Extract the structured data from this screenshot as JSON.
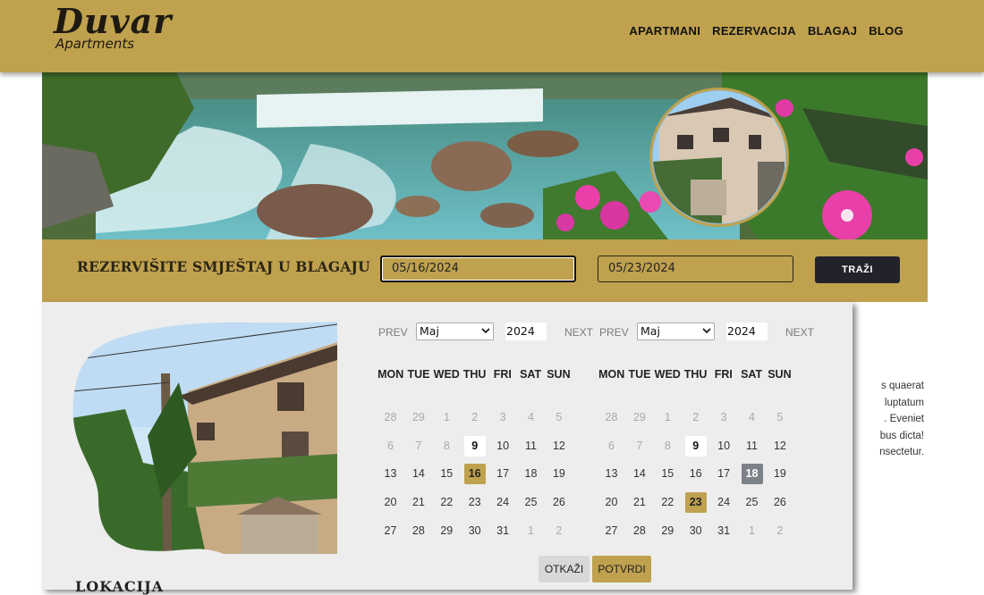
{
  "header": {
    "logo_main": "Duvar",
    "logo_sub": "Apartments",
    "nav": [
      "APARTMANI",
      "REZERVACIJA",
      "BLAGAJ",
      "BLOG"
    ]
  },
  "booking": {
    "title": "REZERVIŠITE SMJEŠTAJ U BLAGAJU",
    "check_in": "05/16/2024",
    "check_out": "05/23/2024",
    "search_label": "TRAŽI"
  },
  "content": {
    "lorem_lines": [
      "s quaerat",
      "luptatum",
      ". Eveniet",
      "bus dicta!",
      "nsectetur."
    ],
    "section_title": "LOKACIJA"
  },
  "datepicker": {
    "weekdays": [
      "MON",
      "TUE",
      "WED",
      "THU",
      "FRI",
      "SAT",
      "SUN"
    ],
    "calendars": [
      {
        "prev_label": "PREV",
        "next_label": "NEXT",
        "month": "Maj",
        "year": "2024",
        "weeks": [
          [
            "28",
            "29",
            "1",
            "2",
            "3",
            "4",
            "5"
          ],
          [
            "6",
            "7",
            "8",
            "9",
            "10",
            "11",
            "12"
          ],
          [
            "13",
            "14",
            "15",
            "16",
            "17",
            "18",
            "19"
          ],
          [
            "20",
            "21",
            "22",
            "23",
            "24",
            "25",
            "26"
          ],
          [
            "27",
            "28",
            "29",
            "30",
            "31",
            "1",
            "2"
          ]
        ],
        "muted": [
          [
            0,
            0
          ],
          [
            0,
            1
          ],
          [
            0,
            2
          ],
          [
            0,
            3
          ],
          [
            0,
            4
          ],
          [
            0,
            5
          ],
          [
            0,
            6
          ],
          [
            1,
            0
          ],
          [
            1,
            1
          ],
          [
            1,
            2
          ],
          [
            4,
            5
          ],
          [
            4,
            6
          ]
        ],
        "today": [
          1,
          3
        ],
        "selected": [
          2,
          3
        ],
        "selected_style": "gold"
      },
      {
        "prev_label": "PREV",
        "next_label": "NEXT",
        "month": "Maj",
        "year": "2024",
        "weeks": [
          [
            "28",
            "29",
            "1",
            "2",
            "3",
            "4",
            "5"
          ],
          [
            "6",
            "7",
            "8",
            "9",
            "10",
            "11",
            "12"
          ],
          [
            "13",
            "14",
            "15",
            "16",
            "17",
            "18",
            "19"
          ],
          [
            "20",
            "21",
            "22",
            "23",
            "24",
            "25",
            "26"
          ],
          [
            "27",
            "28",
            "29",
            "30",
            "31",
            "1",
            "2"
          ]
        ],
        "muted": [
          [
            0,
            0
          ],
          [
            0,
            1
          ],
          [
            0,
            2
          ],
          [
            0,
            3
          ],
          [
            0,
            4
          ],
          [
            0,
            5
          ],
          [
            0,
            6
          ],
          [
            1,
            0
          ],
          [
            1,
            1
          ],
          [
            1,
            2
          ],
          [
            4,
            5
          ],
          [
            4,
            6
          ]
        ],
        "today": [
          1,
          3
        ],
        "selected": [
          3,
          3
        ],
        "hover": [
          2,
          5
        ],
        "selected_style": "gold"
      }
    ],
    "cancel_label": "OTKAŽI",
    "confirm_label": "POTVRDI"
  },
  "colors": {
    "gold": "#bfa14e",
    "dark": "#22232a",
    "panel": "#ededed",
    "hover_grey": "#7d8288"
  },
  "icons": [
    "chevron-down-icon"
  ]
}
